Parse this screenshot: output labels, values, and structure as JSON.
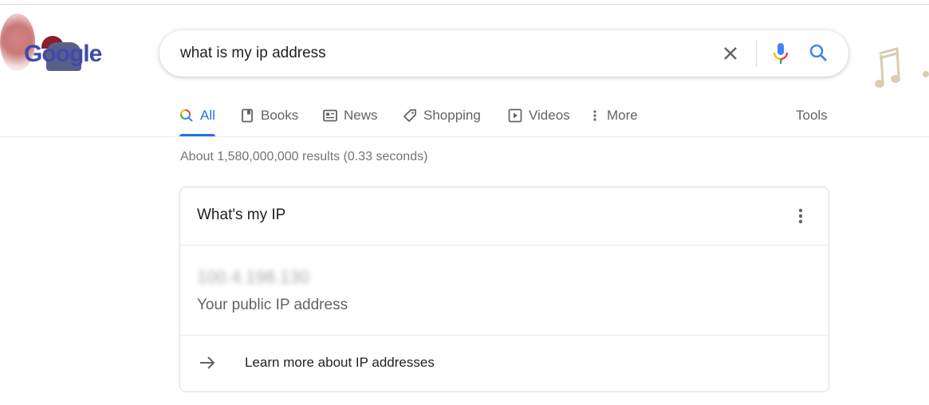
{
  "logo": {
    "text": "Google",
    "variant": "doodle"
  },
  "search": {
    "query": "what is my ip address",
    "clear_icon": "close-icon",
    "voice_icon": "mic-icon",
    "search_icon": "search-icon"
  },
  "tabs": {
    "items": [
      {
        "label": "All",
        "icon": "search-icon",
        "active": true
      },
      {
        "label": "Books",
        "icon": "book-icon"
      },
      {
        "label": "News",
        "icon": "newspaper-icon"
      },
      {
        "label": "Shopping",
        "icon": "tag-icon"
      },
      {
        "label": "Videos",
        "icon": "play-icon"
      },
      {
        "label": "More",
        "icon": "vertical-dots-icon"
      }
    ],
    "tools_label": "Tools"
  },
  "results": {
    "stats": "About 1,580,000,000 results (0.33 seconds)"
  },
  "ip_card": {
    "title": "What's my IP",
    "ip_value_blurred": "100.4.198.130",
    "ip_label": "Your public IP address",
    "learn_more": "Learn more about IP addresses"
  },
  "colors": {
    "accent": "#1a73e8",
    "text": "#202124",
    "muted": "#70757a"
  }
}
